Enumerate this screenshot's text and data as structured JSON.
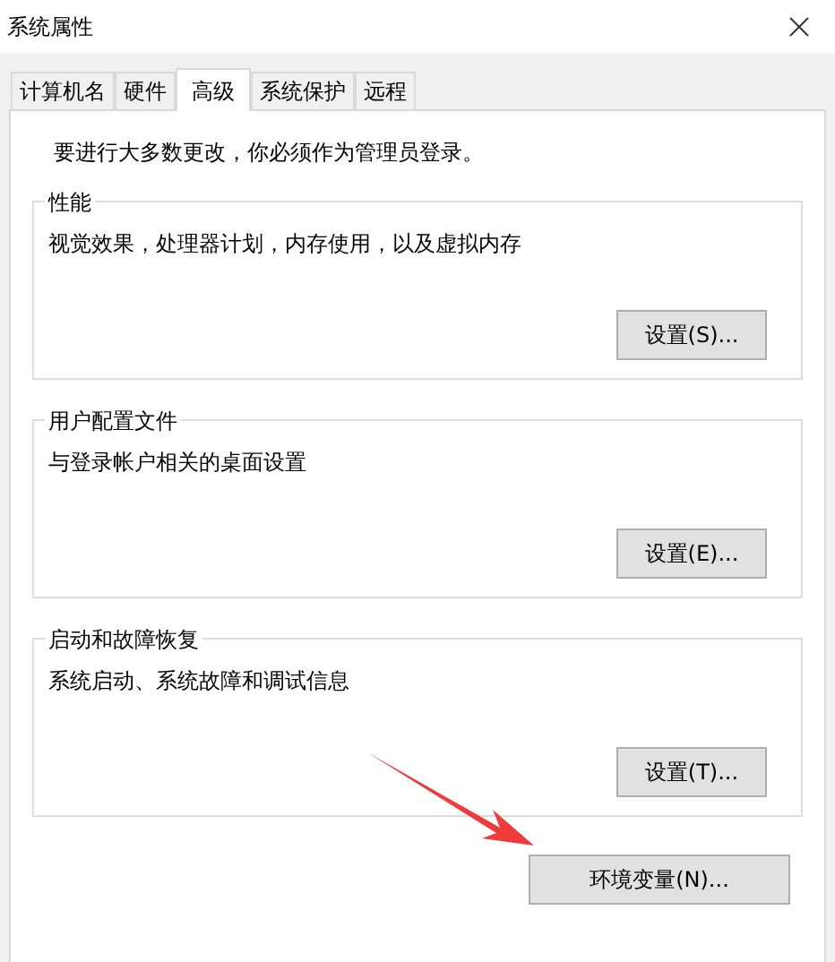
{
  "window": {
    "title": "系统属性"
  },
  "tabs": [
    {
      "label": "计算机名",
      "selected": false
    },
    {
      "label": "硬件",
      "selected": false
    },
    {
      "label": "高级",
      "selected": true
    },
    {
      "label": "系统保护",
      "selected": false
    },
    {
      "label": "远程",
      "selected": false
    }
  ],
  "notice": "要进行大多数更改，你必须作为管理员登录。",
  "groups": [
    {
      "title": "性能",
      "description": "视觉效果，处理器计划，内存使用，以及虚拟内存",
      "button": "设置(S)..."
    },
    {
      "title": "用户配置文件",
      "description": "与登录帐户相关的桌面设置",
      "button": "设置(E)..."
    },
    {
      "title": "启动和故障恢复",
      "description": "系统启动、系统故障和调试信息",
      "button": "设置(T)..."
    }
  ],
  "environment_button": "环境变量(N)..."
}
